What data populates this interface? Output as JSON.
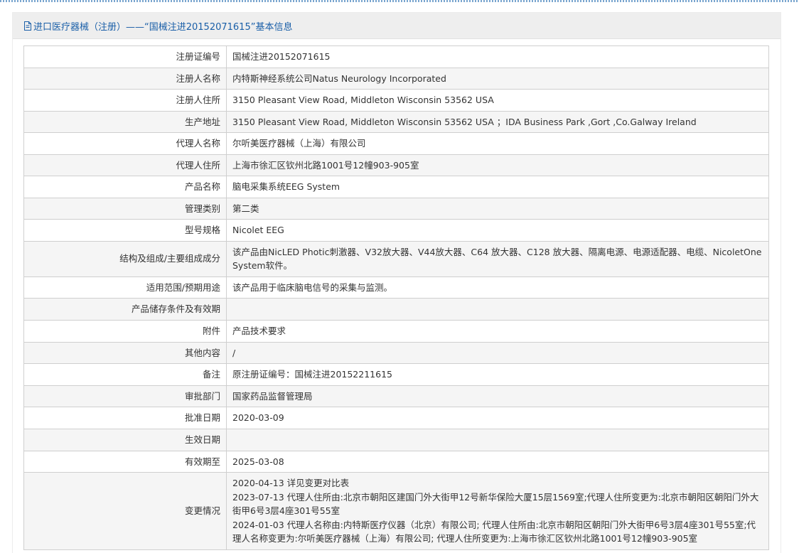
{
  "header": {
    "title": "进口医疗器械（注册）——“国械注进20152071615”基本信息",
    "icon": "document-icon"
  },
  "rows": [
    {
      "label": "注册证编号",
      "value": "国械注进20152071615"
    },
    {
      "label": "注册人名称",
      "value": "内特斯神经系统公司Natus Neurology Incorporated"
    },
    {
      "label": "注册人住所",
      "value": "3150 Pleasant View Road, Middleton Wisconsin 53562 USA"
    },
    {
      "label": "生产地址",
      "value": "3150 Pleasant View Road, Middleton Wisconsin 53562 USA ；IDA Business Park ,Gort ,Co.Galway Ireland"
    },
    {
      "label": "代理人名称",
      "value": "尔听美医疗器械（上海）有限公司"
    },
    {
      "label": "代理人住所",
      "value": "上海市徐汇区钦州北路1001号12幢903-905室"
    },
    {
      "label": "产品名称",
      "value": "脑电采集系统EEG System"
    },
    {
      "label": "管理类别",
      "value": "第二类"
    },
    {
      "label": "型号规格",
      "value": "Nicolet EEG"
    },
    {
      "label": "结构及组成/主要组成成分",
      "value": "该产品由NicLED Photic刺激器、V32放大器、V44放大器、C64 放大器、C128 放大器、隔离电源、电源适配器、电缆、NicoletOne System软件。"
    },
    {
      "label": "适用范围/预期用途",
      "value": "该产品用于临床脑电信号的采集与监测。"
    },
    {
      "label": "产品储存条件及有效期",
      "value": ""
    },
    {
      "label": "附件",
      "value": "产品技术要求"
    },
    {
      "label": "其他内容",
      "value": "/"
    },
    {
      "label": "备注",
      "value": "原注册证编号：国械注进20152211615"
    },
    {
      "label": "审批部门",
      "value": "国家药品监督管理局"
    },
    {
      "label": "批准日期",
      "value": "2020-03-09"
    },
    {
      "label": "生效日期",
      "value": ""
    },
    {
      "label": "有效期至",
      "value": "2025-03-08"
    }
  ],
  "changes": {
    "label": "变更情况",
    "lines": [
      "2020-04-13 详见变更对比表",
      "2023-07-13 代理人住所由:北京市朝阳区建国门外大街甲12号新华保险大厦15层1569室;代理人住所变更为:北京市朝阳区朝阳门外大街甲6号3层4座301号55室",
      "2024-01-03 代理人名称由:内特斯医疗仪器（北京）有限公司; 代理人住所由:北京市朝阳区朝阳门外大街甲6号3层4座301号55室;代理人名称变更为:尔听美医疗器械（上海）有限公司; 代理人住所变更为:上海市徐汇区钦州北路1001号12幢903-905室"
    ]
  }
}
